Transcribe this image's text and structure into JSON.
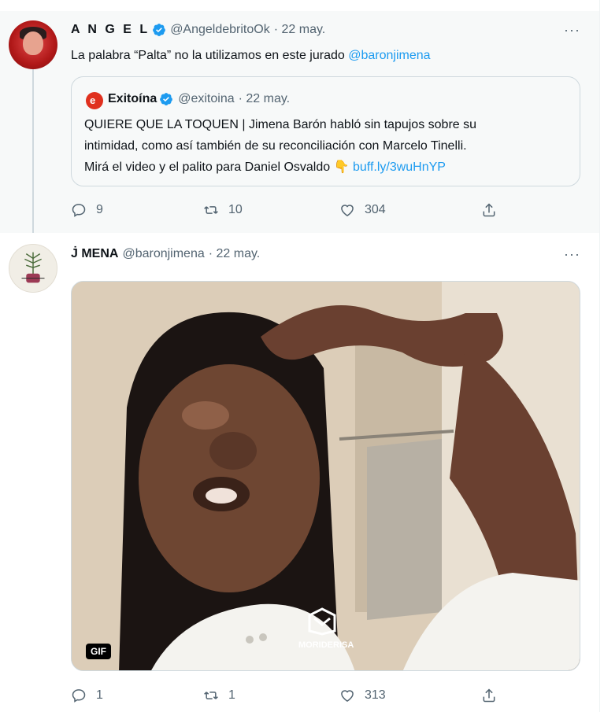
{
  "tweet1": {
    "display_name": "A N G E L",
    "handle": "@AngeldebritoOk",
    "date": "· 22 may.",
    "text_prefix": "La palabra “Palta” no la utilizamos en este jurado",
    "mention": "@baronjimena",
    "quote": {
      "display_name": "Exitoína",
      "handle": "@exitoina",
      "date": "· 22 may.",
      "line1": "QUIERE QUE LA TOQUEN | Jimena Barón habló sin tapujos sobre su",
      "line2": "intimidad, como así también de su reconciliación con Marcelo Tinelli.",
      "line3_prefix": "Mirá el video y el palito para Daniel Osvaldo",
      "line3_emoji": "👇",
      "line3_link": "buff.ly/3wuHnYP"
    },
    "replies": "9",
    "retweets": "10",
    "likes": "304"
  },
  "tweet2": {
    "display_name": "J̇ MENA",
    "handle": "@baronjimena",
    "date": "· 22 may.",
    "media_badge": "GIF",
    "watermark": "MORIDERISA",
    "replies": "1",
    "retweets": "1",
    "likes": "313"
  },
  "more_label": "···",
  "icons": {
    "reply": "reply-icon",
    "retweet": "retweet-icon",
    "like": "heart-icon",
    "share": "share-icon",
    "verified": "verified-badge-icon"
  },
  "colors": {
    "link": "#1d9bf0",
    "muted": "#536471",
    "verified": "#1d9bf0",
    "thread_bg": "#f7f9f9"
  }
}
